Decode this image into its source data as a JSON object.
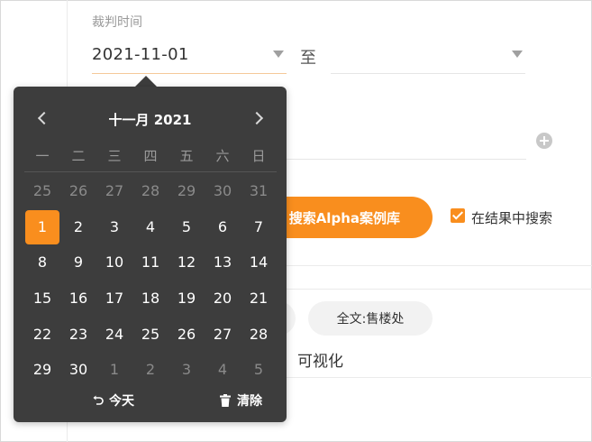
{
  "form": {
    "time_label": "裁判时间",
    "start_date": "2021-11-01",
    "to_label": "至",
    "end_date": ""
  },
  "search": {
    "button_label": "搜索Alpha案例库",
    "in_results_label": "在结果中搜索",
    "in_results_checked": true
  },
  "tags": [
    {
      "label": ""
    },
    {
      "label": "全文:售楼处"
    }
  ],
  "tabs": {
    "visualize_label": "可视化"
  },
  "date_picker": {
    "title": "十一月 2021",
    "weekdays": [
      "一",
      "二",
      "三",
      "四",
      "五",
      "六",
      "日"
    ],
    "weeks": [
      [
        {
          "d": "25",
          "m": true
        },
        {
          "d": "26",
          "m": true
        },
        {
          "d": "27",
          "m": true
        },
        {
          "d": "28",
          "m": true
        },
        {
          "d": "29",
          "m": true
        },
        {
          "d": "30",
          "m": true
        },
        {
          "d": "31",
          "m": true
        }
      ],
      [
        {
          "d": "1",
          "s": true
        },
        {
          "d": "2"
        },
        {
          "d": "3"
        },
        {
          "d": "4"
        },
        {
          "d": "5"
        },
        {
          "d": "6"
        },
        {
          "d": "7"
        }
      ],
      [
        {
          "d": "8"
        },
        {
          "d": "9"
        },
        {
          "d": "10"
        },
        {
          "d": "11"
        },
        {
          "d": "12"
        },
        {
          "d": "13"
        },
        {
          "d": "14"
        }
      ],
      [
        {
          "d": "15"
        },
        {
          "d": "16"
        },
        {
          "d": "17"
        },
        {
          "d": "18"
        },
        {
          "d": "19"
        },
        {
          "d": "20"
        },
        {
          "d": "21"
        }
      ],
      [
        {
          "d": "22"
        },
        {
          "d": "23"
        },
        {
          "d": "24"
        },
        {
          "d": "25"
        },
        {
          "d": "26"
        },
        {
          "d": "27"
        },
        {
          "d": "28"
        }
      ],
      [
        {
          "d": "29"
        },
        {
          "d": "30"
        },
        {
          "d": "1",
          "m": true
        },
        {
          "d": "2",
          "m": true
        },
        {
          "d": "3",
          "m": true
        },
        {
          "d": "4",
          "m": true
        },
        {
          "d": "5",
          "m": true
        }
      ]
    ],
    "today_label": "今天",
    "clear_label": "清除"
  },
  "colors": {
    "accent": "#f98e1e",
    "picker_bg": "#3d3d3d"
  },
  "icons": {
    "prev": "chevron-left-icon",
    "next": "chevron-right-icon",
    "today": "undo-icon",
    "clear": "trash-icon",
    "add": "plus-circle-icon",
    "dropdown": "caret-down-icon"
  }
}
